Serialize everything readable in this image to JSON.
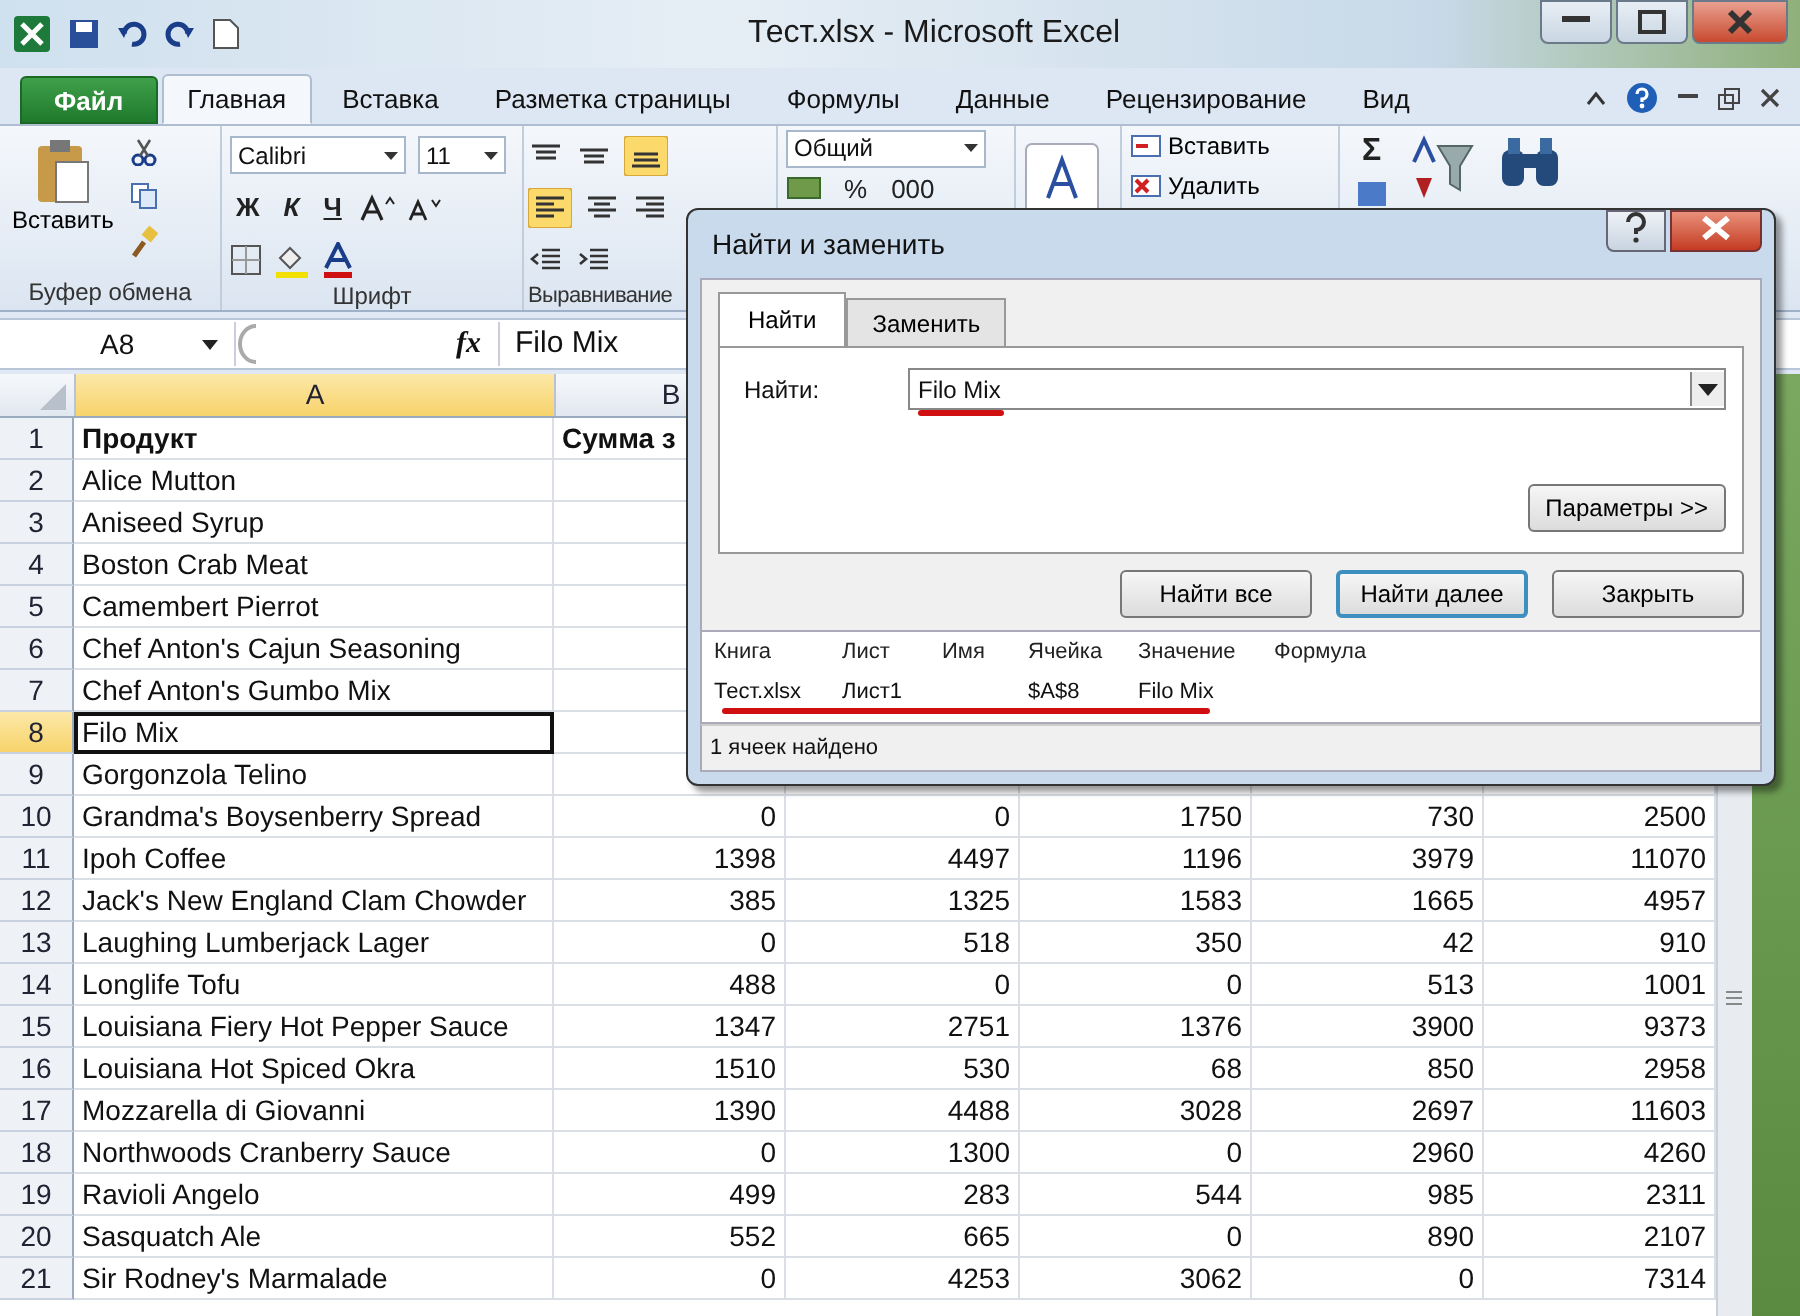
{
  "window": {
    "title": "Тест.xlsx - Microsoft Excel"
  },
  "ribbon_tabs": [
    {
      "label": "Файл",
      "kind": "file",
      "selected": false
    },
    {
      "label": "Главная",
      "kind": "tab",
      "selected": true
    },
    {
      "label": "Вставка",
      "kind": "tab",
      "selected": false
    },
    {
      "label": "Разметка страницы",
      "kind": "tab",
      "selected": false
    },
    {
      "label": "Формулы",
      "kind": "tab",
      "selected": false
    },
    {
      "label": "Данные",
      "kind": "tab",
      "selected": false
    },
    {
      "label": "Рецензирование",
      "kind": "tab",
      "selected": false
    },
    {
      "label": "Вид",
      "kind": "tab",
      "selected": false
    }
  ],
  "ribbon": {
    "paste": "Вставить",
    "clipboard_label": "Буфер обмена",
    "font": "Calibri",
    "size": "11",
    "bold": "Ж",
    "italic": "К",
    "underline": "Ч",
    "font_label": "Шрифт",
    "align_label": "Выравнивание",
    "number_format": "Общий",
    "percent": "%",
    "thousands": "000",
    "insert": "Вставить",
    "delete": "Удалить",
    "sum": "Σ"
  },
  "formula_bar": {
    "name_box": "A8",
    "fx": "fx",
    "value": "Filo Mix"
  },
  "columns": [
    {
      "label": "A",
      "selected": true
    },
    {
      "label": "B",
      "selected": false
    }
  ],
  "rows": [
    {
      "num": "1",
      "kind": "header",
      "selected": false,
      "cells": [
        "Продукт",
        "Сумма з"
      ]
    },
    {
      "num": "2",
      "kind": "data",
      "selected": false,
      "cells": [
        "Alice Mutton"
      ]
    },
    {
      "num": "3",
      "kind": "data",
      "selected": false,
      "cells": [
        "Aniseed Syrup"
      ]
    },
    {
      "num": "4",
      "kind": "data",
      "selected": false,
      "cells": [
        "Boston Crab Meat"
      ]
    },
    {
      "num": "5",
      "kind": "data",
      "selected": false,
      "cells": [
        "Camembert Pierrot"
      ]
    },
    {
      "num": "6",
      "kind": "data",
      "selected": false,
      "cells": [
        "Chef Anton's Cajun Seasoning"
      ]
    },
    {
      "num": "7",
      "kind": "data",
      "selected": false,
      "cells": [
        "Chef Anton's Gumbo Mix"
      ]
    },
    {
      "num": "8",
      "kind": "data",
      "selected": true,
      "cells": [
        "Filo Mix"
      ]
    },
    {
      "num": "9",
      "kind": "data",
      "selected": false,
      "cells": [
        "Gorgonzola Telino"
      ]
    },
    {
      "num": "10",
      "kind": "data",
      "selected": false,
      "cells": [
        "Grandma's Boysenberry Spread",
        "0",
        "0",
        "1750",
        "730",
        "2500"
      ]
    },
    {
      "num": "11",
      "kind": "data",
      "selected": false,
      "cells": [
        "Ipoh Coffee",
        "1398",
        "4497",
        "1196",
        "3979",
        "11070"
      ]
    },
    {
      "num": "12",
      "kind": "data",
      "selected": false,
      "cells": [
        "Jack's New England Clam Chowder",
        "385",
        "1325",
        "1583",
        "1665",
        "4957"
      ]
    },
    {
      "num": "13",
      "kind": "data",
      "selected": false,
      "cells": [
        "Laughing Lumberjack Lager",
        "0",
        "518",
        "350",
        "42",
        "910"
      ]
    },
    {
      "num": "14",
      "kind": "data",
      "selected": false,
      "cells": [
        "Longlife Tofu",
        "488",
        "0",
        "0",
        "513",
        "1001"
      ]
    },
    {
      "num": "15",
      "kind": "data",
      "selected": false,
      "cells": [
        "Louisiana Fiery Hot Pepper Sauce",
        "1347",
        "2751",
        "1376",
        "3900",
        "9373"
      ]
    },
    {
      "num": "16",
      "kind": "data",
      "selected": false,
      "cells": [
        "Louisiana Hot Spiced Okra",
        "1510",
        "530",
        "68",
        "850",
        "2958"
      ]
    },
    {
      "num": "17",
      "kind": "data",
      "selected": false,
      "cells": [
        "Mozzarella di Giovanni",
        "1390",
        "4488",
        "3028",
        "2697",
        "11603"
      ]
    },
    {
      "num": "18",
      "kind": "data",
      "selected": false,
      "cells": [
        "Northwoods Cranberry Sauce",
        "0",
        "1300",
        "0",
        "2960",
        "4260"
      ]
    },
    {
      "num": "19",
      "kind": "data",
      "selected": false,
      "cells": [
        "Ravioli Angelo",
        "499",
        "283",
        "544",
        "985",
        "2311"
      ]
    },
    {
      "num": "20",
      "kind": "data",
      "selected": false,
      "cells": [
        "Sasquatch Ale",
        "552",
        "665",
        "0",
        "890",
        "2107"
      ]
    },
    {
      "num": "21",
      "kind": "data",
      "selected": false,
      "cells": [
        "Sir Rodney's Marmalade",
        "0",
        "4253",
        "3062",
        "0",
        "7314"
      ]
    }
  ],
  "dialog": {
    "title": "Найти и заменить",
    "tabs": [
      {
        "label": "Найти",
        "selected": true
      },
      {
        "label": "Заменить",
        "selected": false
      }
    ],
    "find_label": "Найти:",
    "find_value": "Filo Mix",
    "find_underlined": true,
    "options_button": "Параметры >>",
    "buttons": [
      {
        "label": "Найти все",
        "default": false
      },
      {
        "label": "Найти далее",
        "default": true
      },
      {
        "label": "Закрыть",
        "default": false
      }
    ],
    "result_columns": [
      "Книга",
      "Лист",
      "Имя",
      "Ячейка",
      "Значение",
      "Формула"
    ],
    "results": [
      {
        "book": "Тест.xlsx",
        "sheet": "Лист1",
        "cell": "$A$8",
        "value": "Filo Mix",
        "underlined": true
      }
    ],
    "status": "1 ячеек найдено"
  }
}
